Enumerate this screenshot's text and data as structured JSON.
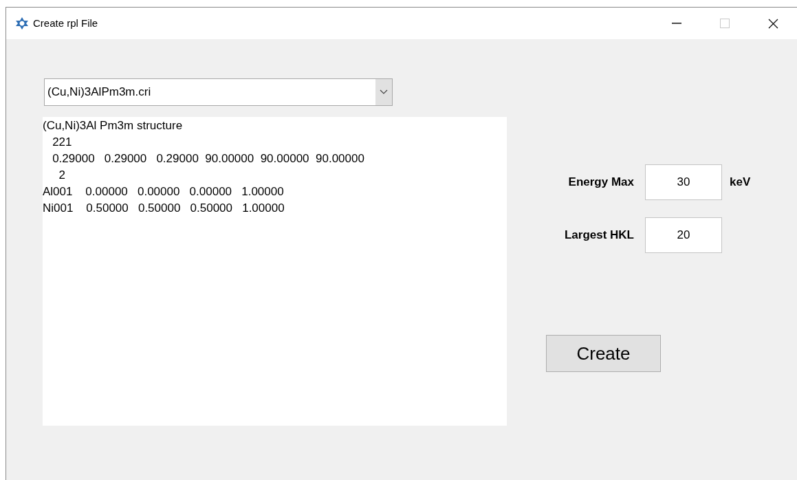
{
  "window": {
    "title": "Create rpl File"
  },
  "file_select": {
    "value": "(Cu,Ni)3AlPm3m.cri"
  },
  "file_contents": [
    "(Cu,Ni)3Al Pm3m structure",
    "   221",
    "   0.29000   0.29000   0.29000  90.00000  90.00000  90.00000",
    "     2",
    "Al001    0.00000   0.00000   0.00000   1.00000",
    "Ni001    0.50000   0.50000   0.50000   1.00000"
  ],
  "fields": [
    {
      "label": "Energy Max",
      "value": "30",
      "unit": "keV"
    },
    {
      "label": "Largest HKL",
      "value": "20"
    }
  ],
  "buttons": [
    "Create"
  ]
}
